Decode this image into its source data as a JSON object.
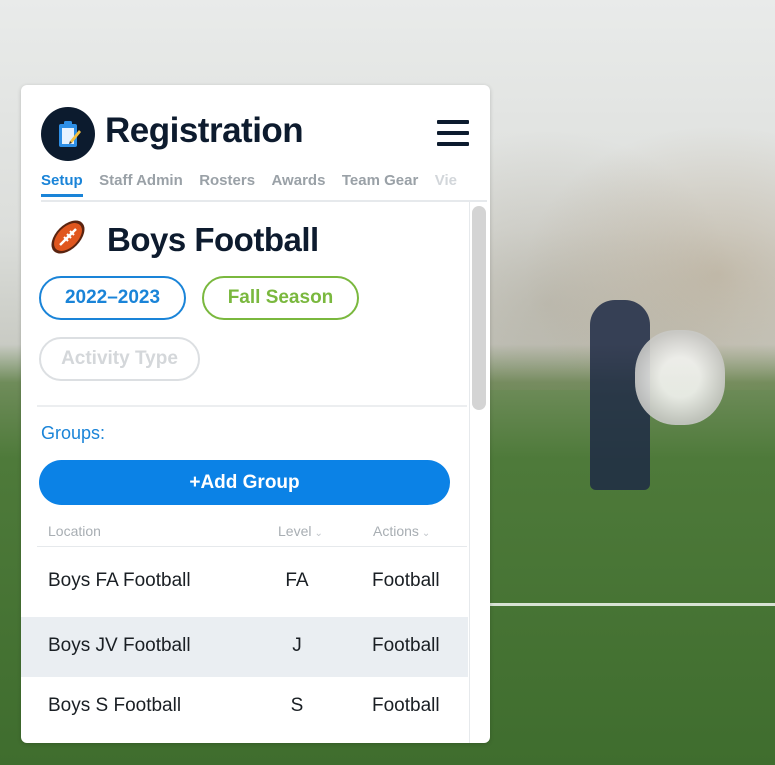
{
  "app": {
    "title": "Registration",
    "logo_icon": "clipboard-pencil-icon",
    "menu_icon": "hamburger-menu-icon"
  },
  "tabs": [
    {
      "label": "Setup",
      "active": true
    },
    {
      "label": "Staff Admin",
      "active": false
    },
    {
      "label": "Rosters",
      "active": false
    },
    {
      "label": "Awards",
      "active": false
    },
    {
      "label": "Team Gear",
      "active": false
    },
    {
      "label": "Vie",
      "active": false
    }
  ],
  "sport": {
    "icon": "american-football-icon",
    "title": "Boys Football"
  },
  "filters": {
    "year": "2022–2023",
    "season": "Fall Season",
    "activity_type_placeholder": "Activity Type"
  },
  "colors": {
    "accent_blue": "#1a84d8",
    "button_blue": "#0b82e6",
    "season_green": "#7ab83e",
    "title_navy": "#0d1b2e"
  },
  "groups": {
    "label": "Groups:",
    "add_button": "+Add Group",
    "columns": {
      "location": "Location",
      "level": "Level",
      "actions": "Actions"
    },
    "rows": [
      {
        "location": "Boys FA Football",
        "level": "FA",
        "action": "Football"
      },
      {
        "location": "Boys JV Football",
        "level": "J",
        "action": "Football"
      },
      {
        "location": "Boys S Football",
        "level": "S",
        "action": "Football"
      }
    ]
  }
}
